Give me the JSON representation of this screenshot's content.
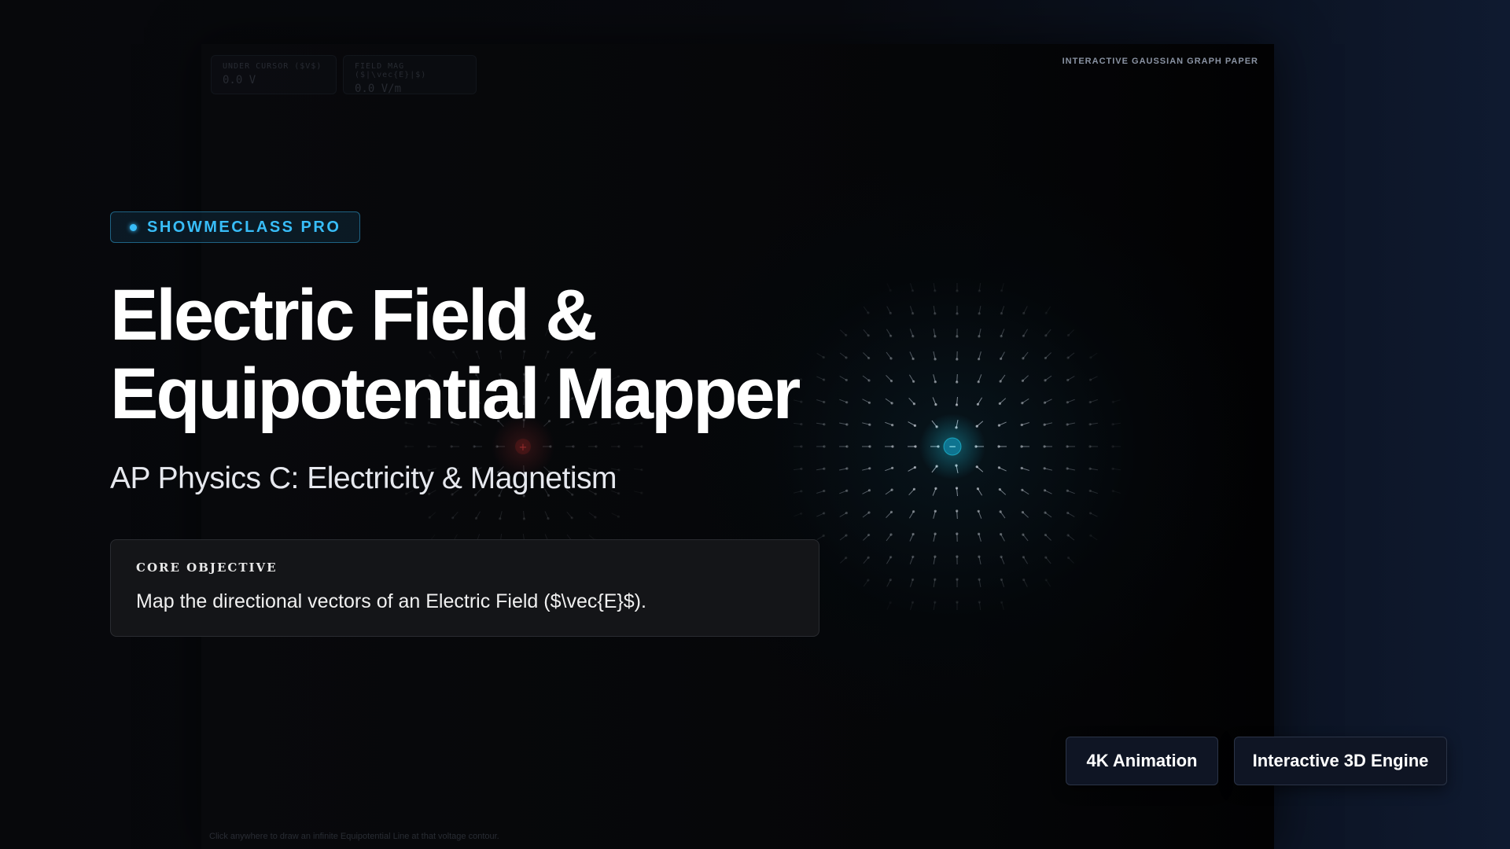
{
  "stage": {
    "label": "INTERACTIVE GAUSSIAN GRAPH PAPER",
    "readouts": [
      {
        "label": "UNDER CURSOR ($V$)",
        "value": "0.0 V"
      },
      {
        "label": "FIELD MAG ($|\\vec{E}|$)",
        "value": "0.0 V/m"
      }
    ],
    "hint": "Click anywhere to draw an infinite Equipotential Line at that voltage contour.",
    "charges": [
      {
        "sign": "+",
        "color": "#ef4444"
      },
      {
        "sign": "−",
        "color": "#22d3ee"
      }
    ]
  },
  "brand": {
    "label": "SHOWMECLASS PRO",
    "accent": "#38bdf8"
  },
  "title": {
    "line1": "Electric Field &",
    "line2": "Equipotential Mapper"
  },
  "subtitle": "AP Physics C: Electricity & Magnetism",
  "objective": {
    "label": "CORE OBJECTIVE",
    "text": "Map the directional vectors of an Electric Field ($\\vec{E}$)."
  },
  "badges": [
    "4K Animation",
    "Interactive 3D Engine"
  ]
}
